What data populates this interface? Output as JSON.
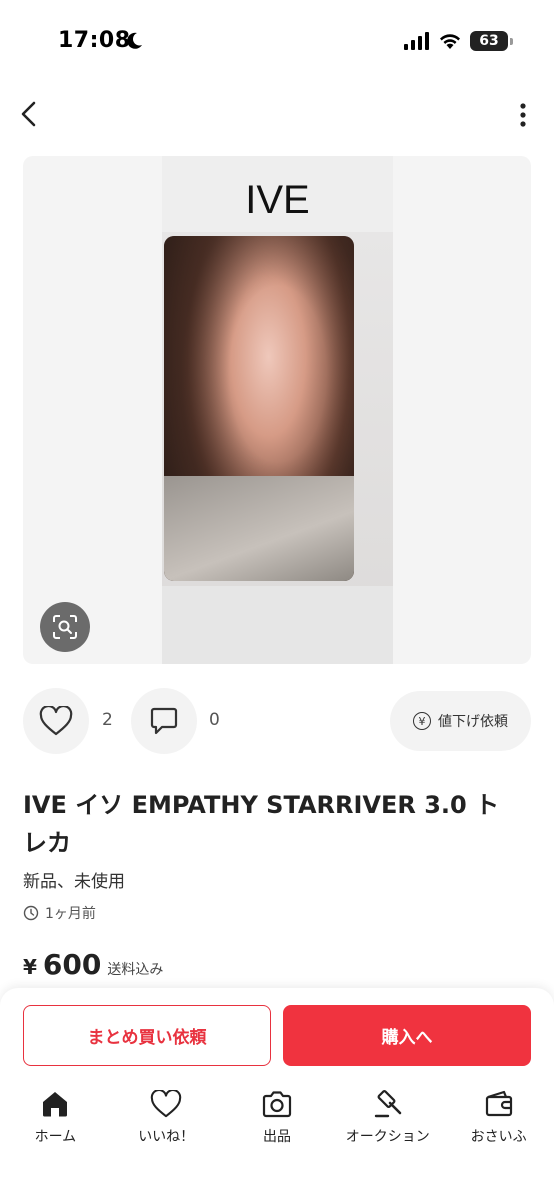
{
  "status": {
    "time": "17:08",
    "battery": "63"
  },
  "photo": {
    "label": "IVE"
  },
  "actions": {
    "likes": "2",
    "comments": "0",
    "price_drop": "値下げ依頼"
  },
  "item": {
    "title": "IVE イソ EMPATHY STARRIVER 3.0 トレカ",
    "condition": "新品、未使用",
    "posted": "1ヶ月前",
    "currency": "¥",
    "price": "600",
    "shipping": "送料込み"
  },
  "buttons": {
    "bundle": "まとめ買い依頼",
    "buy": "購入へ"
  },
  "tabs": [
    {
      "label": "ホーム",
      "icon": "home-icon"
    },
    {
      "label": "いいね！",
      "icon": "heart-icon"
    },
    {
      "label": "出品",
      "icon": "camera-icon"
    },
    {
      "label": "オークション",
      "icon": "gavel-icon"
    },
    {
      "label": "おさいふ",
      "icon": "wallet-icon"
    }
  ],
  "colors": {
    "accent": "#f0333f"
  }
}
